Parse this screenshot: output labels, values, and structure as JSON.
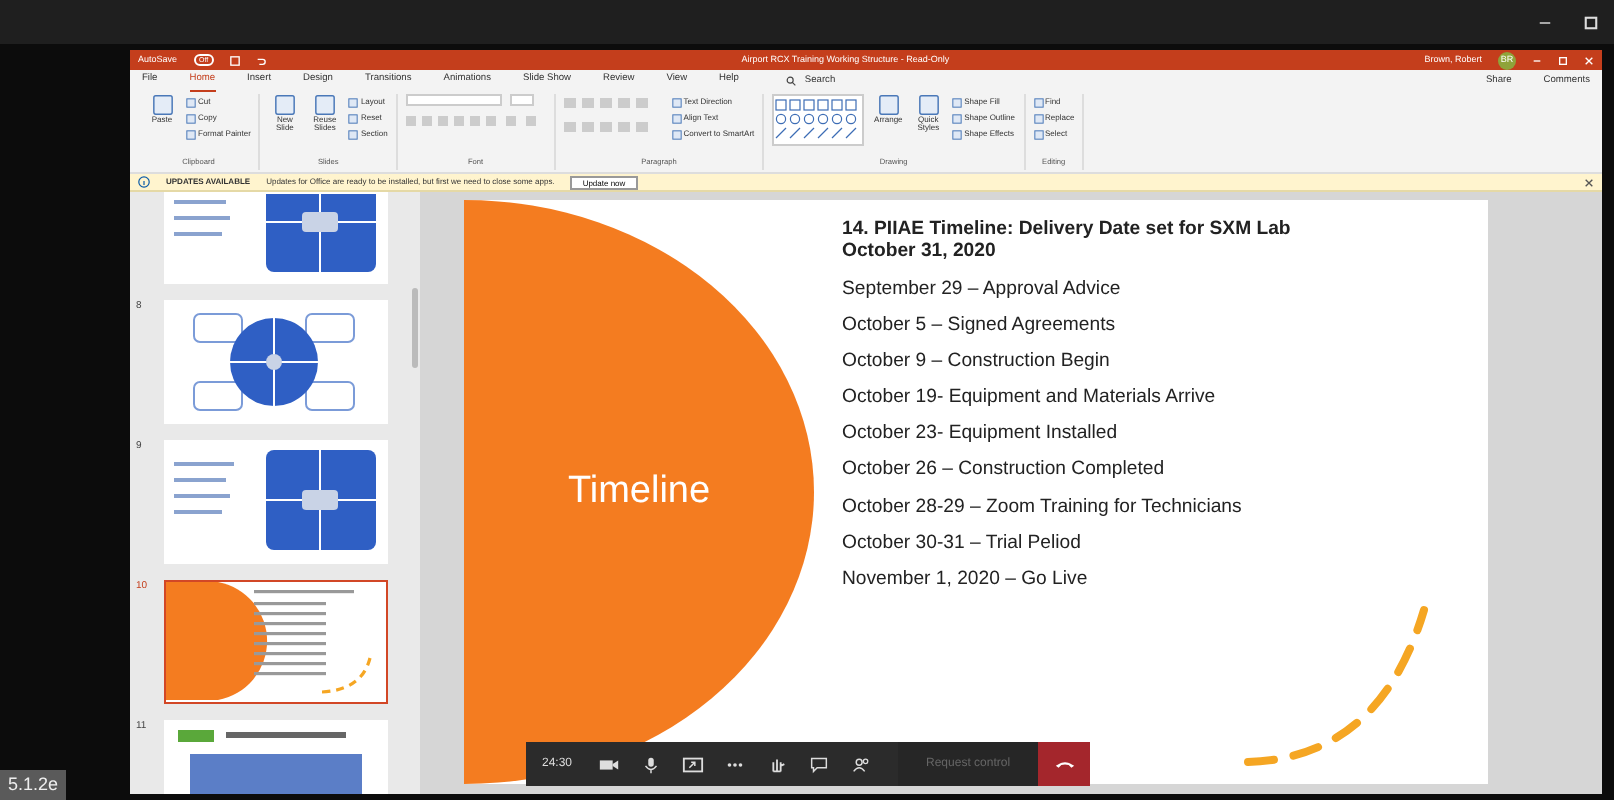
{
  "screen_label": "5.1.2e",
  "window": {
    "autosave": "AutoSave",
    "autosave_state": "Off",
    "title": "Airport RCX Training Working Structure  -  Read-Only",
    "user": "Brown, Robert",
    "avatar": "BR"
  },
  "tabs": [
    {
      "label": "File",
      "selected": false
    },
    {
      "label": "Home",
      "selected": true
    },
    {
      "label": "Insert",
      "selected": false
    },
    {
      "label": "Design",
      "selected": false
    },
    {
      "label": "Transitions",
      "selected": false
    },
    {
      "label": "Animations",
      "selected": false
    },
    {
      "label": "Slide Show",
      "selected": false
    },
    {
      "label": "Review",
      "selected": false
    },
    {
      "label": "View",
      "selected": false
    },
    {
      "label": "Help",
      "selected": false
    }
  ],
  "search": "Search",
  "share": "Share",
  "comments": "Comments",
  "ribbon_groups": [
    {
      "label": "Clipboard",
      "items": [
        {
          "kind": "large",
          "label": "Paste"
        },
        {
          "kind": "small",
          "label": "Cut"
        },
        {
          "kind": "small",
          "label": "Copy"
        },
        {
          "kind": "small",
          "label": "Format Painter"
        }
      ]
    },
    {
      "label": "Slides",
      "items": [
        {
          "kind": "large",
          "label": "New Slide"
        },
        {
          "kind": "large",
          "label": "Reuse Slides"
        },
        {
          "kind": "small",
          "label": "Layout"
        },
        {
          "kind": "small",
          "label": "Reset"
        },
        {
          "kind": "small",
          "label": "Section"
        }
      ]
    },
    {
      "label": "Font",
      "items": [
        {
          "kind": "fields"
        }
      ]
    },
    {
      "label": "Paragraph",
      "items": [
        {
          "kind": "iconrows"
        },
        {
          "kind": "small",
          "label": "Text Direction"
        },
        {
          "kind": "small",
          "label": "Align Text"
        },
        {
          "kind": "small",
          "label": "Convert to SmartArt"
        }
      ]
    },
    {
      "label": "Drawing",
      "items": [
        {
          "kind": "gallery"
        },
        {
          "kind": "large",
          "label": "Arrange"
        },
        {
          "kind": "large",
          "label": "Quick Styles"
        },
        {
          "kind": "small",
          "label": "Shape Fill"
        },
        {
          "kind": "small",
          "label": "Shape Outline"
        },
        {
          "kind": "small",
          "label": "Shape Effects"
        }
      ]
    },
    {
      "label": "Editing",
      "items": [
        {
          "kind": "small",
          "label": "Find"
        },
        {
          "kind": "small",
          "label": "Replace"
        },
        {
          "kind": "small",
          "label": "Select"
        }
      ]
    }
  ],
  "update_bar": {
    "heading": "UPDATES AVAILABLE",
    "message": "Updates for Office are ready to be installed, but first we need to close some apps.",
    "button": "Update now"
  },
  "thumbnails": [
    {
      "kind": "grid",
      "selected": false
    },
    {
      "number": "8",
      "kind": "circle",
      "selected": false
    },
    {
      "number": "9",
      "kind": "grid",
      "selected": false
    },
    {
      "number": "10",
      "kind": "timeline",
      "selected": true
    },
    {
      "number": "11",
      "kind": "table",
      "selected": false
    }
  ],
  "slide": {
    "circle_label": "Timeline",
    "heading": [
      "14.   PIIAE Timeline: Delivery Date set for SXM Lab",
      "October 31, 2020"
    ],
    "items": [
      "September 29 – Approval Advice",
      "October 5 – Signed Agreements",
      "October 9 – Construction Begin",
      "October 19- Equipment and Materials Arrive",
      "October 23- Equipment Installed",
      "October 26 – Construction Completed",
      "October 28-29  – Zoom Training for Technicians",
      "October 30-31 – Trial Peliod",
      "November 1, 2020 – Go Live"
    ]
  },
  "call_toolbar": {
    "timer": "24:30",
    "request_control": "Request control"
  }
}
